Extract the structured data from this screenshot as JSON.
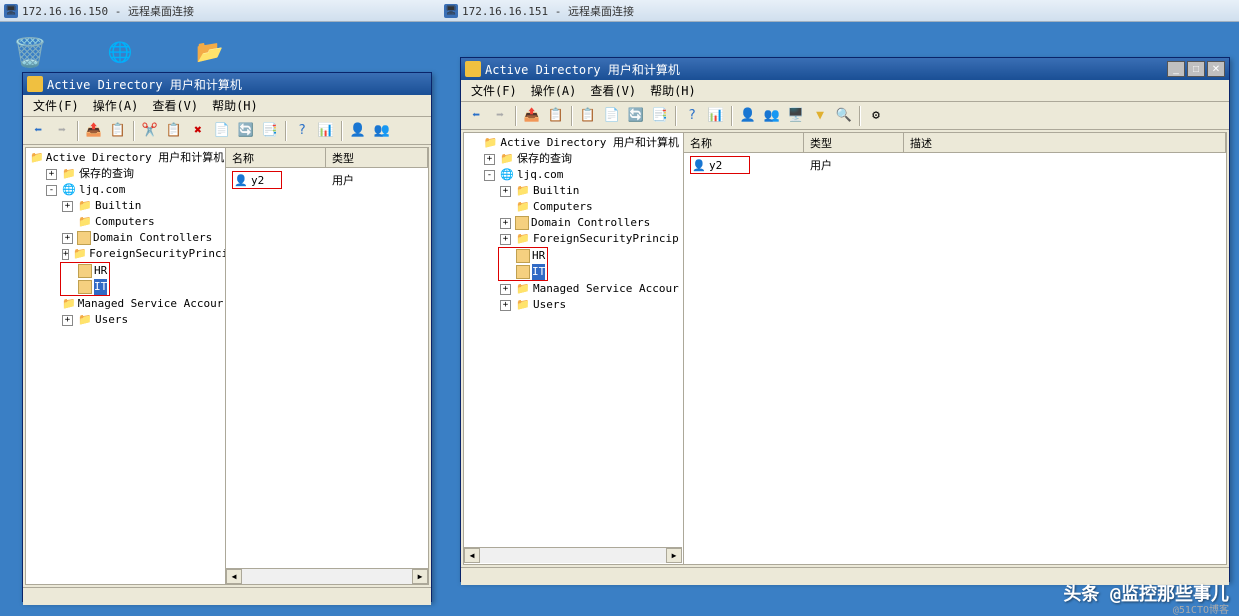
{
  "rdp": {
    "left": {
      "title": "172.16.16.150 - 远程桌面连接"
    },
    "right": {
      "title": "172.16.16.151 - 远程桌面连接"
    }
  },
  "ad_window": {
    "title": "Active Directory 用户和计算机",
    "menus": {
      "file": "文件(F)",
      "action": "操作(A)",
      "view": "查看(V)",
      "help": "帮助(H)"
    },
    "tree": {
      "root": "Active Directory 用户和计算机",
      "saved_queries": "保存的查询",
      "domain": "ljq.com",
      "nodes": {
        "builtin": "Builtin",
        "computers": "Computers",
        "domain_controllers": "Domain Controllers",
        "fsp": "ForeignSecurityPrincip",
        "fsp_right": "ForeignSecurityPrincip",
        "hr": "HR",
        "it": "IT",
        "msa": "Managed Service Accour",
        "users": "Users"
      }
    },
    "list": {
      "cols": {
        "name": "名称",
        "type": "类型",
        "desc": "描述"
      },
      "row": {
        "name": "y2",
        "type": "用户"
      }
    }
  },
  "watermark": {
    "main": "头条 @监控那些事儿",
    "sub": "@51CTO博客"
  }
}
